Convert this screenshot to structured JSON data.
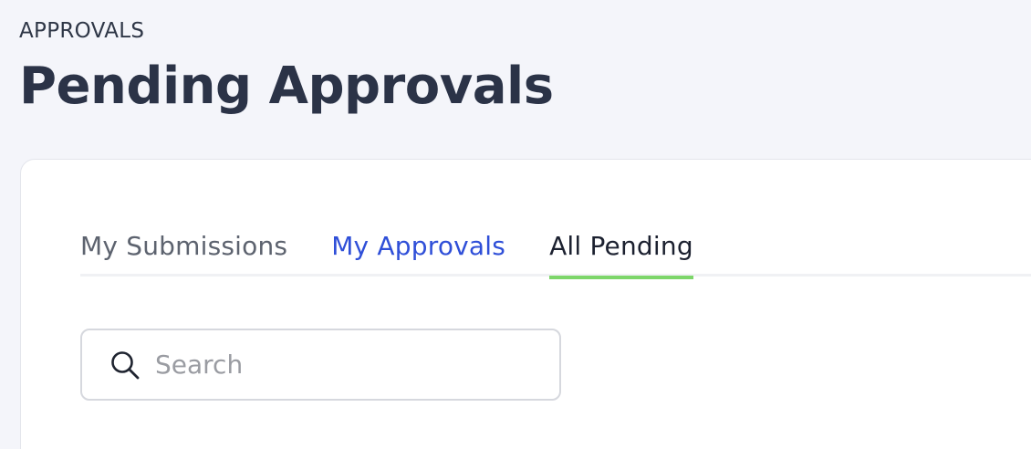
{
  "header": {
    "breadcrumb": "APPROVALS",
    "title": "Pending Approvals"
  },
  "tabs": [
    {
      "label": "My Submissions",
      "active": false
    },
    {
      "label": "My Approvals",
      "active": false
    },
    {
      "label": "All Pending",
      "active": true
    }
  ],
  "search": {
    "placeholder": "Search",
    "value": "",
    "icon": "search-icon"
  },
  "colors": {
    "background": "#f4f5fa",
    "title": "#2b3347",
    "link_tab": "#2f4fd8",
    "active_indicator": "#7dd66a"
  }
}
